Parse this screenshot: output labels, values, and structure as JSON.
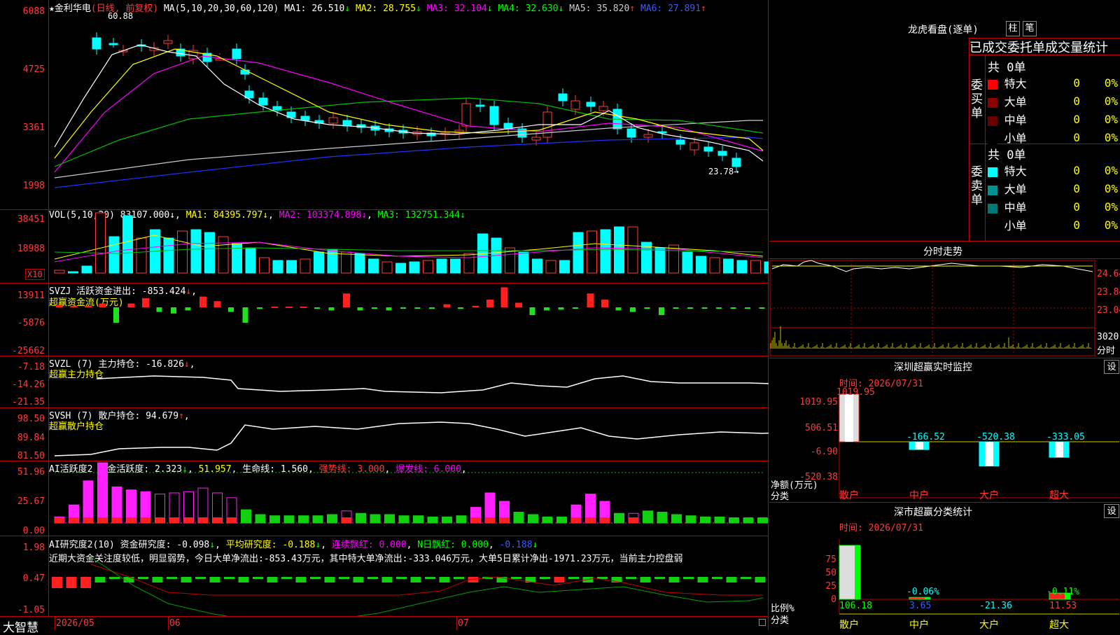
{
  "stock": {
    "name": "金利华电",
    "mode": "(日线, 前复权)",
    "star": "★"
  },
  "main": {
    "ma_label": "MA(5,10,20,30,60,120)",
    "ma": [
      {
        "label": "MA1:",
        "value": "26.510",
        "arrow": "↓",
        "color": "#ffffff"
      },
      {
        "label": "MA2:",
        "value": "28.755",
        "arrow": "↓",
        "color": "#ffff00"
      },
      {
        "label": "MA3:",
        "value": "32.104",
        "arrow": "↓",
        "color": "#ff00ff"
      },
      {
        "label": "MA4:",
        "value": "32.630",
        "arrow": "↓",
        "color": "#00ff00"
      },
      {
        "label": "MA5:",
        "value": "35.820",
        "arrow": "↑",
        "color": "#cccccc"
      },
      {
        "label": "MA6:",
        "value": "27.891",
        "arrow": "↑",
        "color": "#3b5bff"
      }
    ],
    "axis": [
      "6088",
      "4725",
      "3361",
      "1998"
    ],
    "high": "60.88",
    "low": "23.78"
  },
  "vol": {
    "label": "VOL(5,10,20)",
    "value": "83107.000",
    "arrow": "↓",
    "ma1": "84395.797",
    "ma2": "103374.898",
    "ma3": "132751.344",
    "axis": [
      "38451",
      "18988"
    ],
    "unit": "X10"
  },
  "svzj": {
    "label": "SVZJ",
    "title": "活跃资金进出:",
    "value": "-853.424",
    "arrow": "↓",
    "sub": "超赢资金流(万元)",
    "axis": [
      "13911",
      "-5876",
      "-25662"
    ]
  },
  "svzl": {
    "label": "SVZL (7)",
    "title": "主力持仓:",
    "value": "-16.826",
    "arrow": "↓",
    "sub": "超赢主力持仓",
    "axis": [
      "-7.18",
      "-14.26",
      "-21.35"
    ]
  },
  "svsh": {
    "label": "SVSH (7)",
    "title": "散户持仓:",
    "value": "94.679",
    "arrow": "↑",
    "sub": "超赢散户持仓",
    "axis": [
      "98.50",
      "89.84",
      "81.50"
    ]
  },
  "ai1": {
    "label": "AI活跃度2",
    "t1": "资金活跃度:",
    "v1": "2.323",
    "v2": "51.957",
    "t3": "生命线:",
    "v3": "1.560",
    "t4": "强势线:",
    "v4": "3.000",
    "t5": "爆发线:",
    "v5": "6.000",
    "axis": [
      "51.96",
      "25.67",
      "0.00"
    ]
  },
  "ai2": {
    "label": "AI研究度2(10)",
    "t1": "资金研究度:",
    "v1": "-0.098",
    "t2": "平均研究度:",
    "v2": "-0.188",
    "t3": "连续飘红:",
    "v3": "0.000",
    "t4": "N日飘红:",
    "v4": "0.000",
    "v5": "-0.188",
    "axis": [
      "1.98",
      "0.47",
      "-1.05"
    ],
    "comment": "近期大资金关注度较低，明显弱势，今日大单净流出:-853.43万元，其中特大单净流出:-333.046万元，大单5日累计净出-1971.23万元，当前主力控盘弱"
  },
  "bottom": {
    "brand": "大智慧",
    "dates": [
      "2026/05",
      "06",
      "07"
    ]
  },
  "dragon": {
    "title": "龙虎看盘(逐单)",
    "tabs": [
      "柱",
      "笔"
    ],
    "header": "已成交委托单成交量统计",
    "buy": {
      "side": "委买单",
      "total": "共 0单",
      "rows": [
        {
          "name": "特大",
          "v": "0",
          "p": "0%",
          "color": "#ff0000"
        },
        {
          "name": "大单",
          "v": "0",
          "p": "0%",
          "color": "#8b0000"
        },
        {
          "name": "中单",
          "v": "0",
          "p": "0%",
          "color": "#6b0000"
        },
        {
          "name": "小单",
          "v": "0",
          "p": "0%",
          "color": "#000000"
        }
      ]
    },
    "sell": {
      "side": "委卖单",
      "total": "共 0单",
      "rows": [
        {
          "name": "特大",
          "v": "0",
          "p": "0%",
          "color": "#00ffff"
        },
        {
          "name": "大单",
          "v": "0",
          "p": "0%",
          "color": "#009090"
        },
        {
          "name": "中单",
          "v": "0",
          "p": "0%",
          "color": "#007878"
        },
        {
          "name": "小单",
          "v": "0",
          "p": "0%",
          "color": "#000000"
        }
      ]
    }
  },
  "intraday": {
    "title": "分时走势",
    "axis": [
      "24.64",
      "23.84",
      "23.04"
    ],
    "vol": "3020",
    "unit": "分时"
  },
  "monitor": {
    "title": "深圳超赢实时监控",
    "setting": "设",
    "time": "时间: 2026/07/31",
    "axis": [
      "1019.95",
      "506.51",
      "-6.90",
      "-520.38"
    ],
    "ylabel": "净额(万元)",
    "xlabel": "分类",
    "bars": [
      {
        "cat": "散户",
        "value": "1019.95"
      },
      {
        "cat": "中户",
        "value": "-166.52"
      },
      {
        "cat": "大户",
        "value": "-520.38"
      },
      {
        "cat": "超大",
        "value": "-333.05"
      }
    ]
  },
  "classify": {
    "title": "深市超赢分类统计",
    "setting": "设",
    "time": "时间: 2026/07/31",
    "axis": [
      "75",
      "50",
      "25",
      "0"
    ],
    "ylabel": "比例%",
    "xlabel": "分类",
    "bars": [
      {
        "cat": "散户",
        "value": "106.18",
        "pct": ""
      },
      {
        "cat": "中户",
        "value": "3.65",
        "pct": "-0.06%"
      },
      {
        "cat": "大户",
        "value": "-21.36",
        "pct": ""
      },
      {
        "cat": "超大",
        "value": "11.53",
        "pct": "-0.11%"
      }
    ]
  }
}
